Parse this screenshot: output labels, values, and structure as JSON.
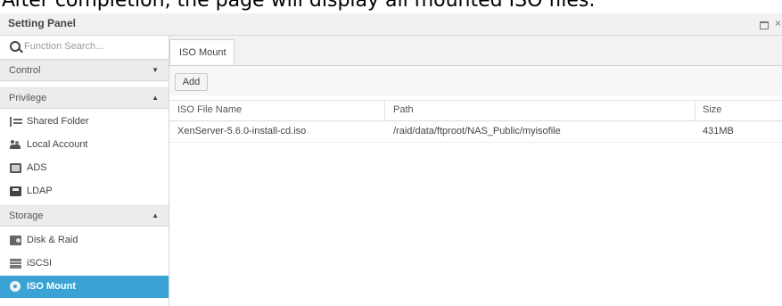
{
  "caption": "After completion, the page will display all mounted ISO files.",
  "window": {
    "title": "Setting Panel",
    "close_glyph": "×"
  },
  "search": {
    "placeholder": "Function Search..."
  },
  "sidebar": {
    "sections": [
      {
        "label": "Control",
        "arrow": "▼"
      },
      {
        "label": "Privilege",
        "arrow": "▲"
      },
      {
        "label": "Storage",
        "arrow": "▲"
      }
    ],
    "privilege_items": [
      {
        "label": "Shared Folder",
        "icon": "shared-folder-icon"
      },
      {
        "label": "Local Account",
        "icon": "local-account-icon"
      },
      {
        "label": "ADS",
        "icon": "ads-icon"
      },
      {
        "label": "LDAP",
        "icon": "ldap-icon"
      }
    ],
    "storage_items": [
      {
        "label": "Disk & Raid",
        "icon": "disk-raid-icon"
      },
      {
        "label": "iSCSI",
        "icon": "iscsi-icon"
      },
      {
        "label": "ISO Mount",
        "icon": "iso-mount-icon",
        "active": true
      }
    ]
  },
  "tabs": [
    {
      "label": "ISO Mount"
    }
  ],
  "toolbar": {
    "add_label": "Add"
  },
  "table": {
    "columns": [
      "ISO File Name",
      "Path",
      "Size"
    ],
    "rows": [
      [
        "XenServer-5.6.0-install-cd.iso",
        "/raid/data/ftproot/NAS_Public/myisofile",
        "431MB"
      ]
    ]
  },
  "colors": {
    "active_item_bg": "#3aa3d4",
    "header_bg": "#f1f1f1"
  }
}
